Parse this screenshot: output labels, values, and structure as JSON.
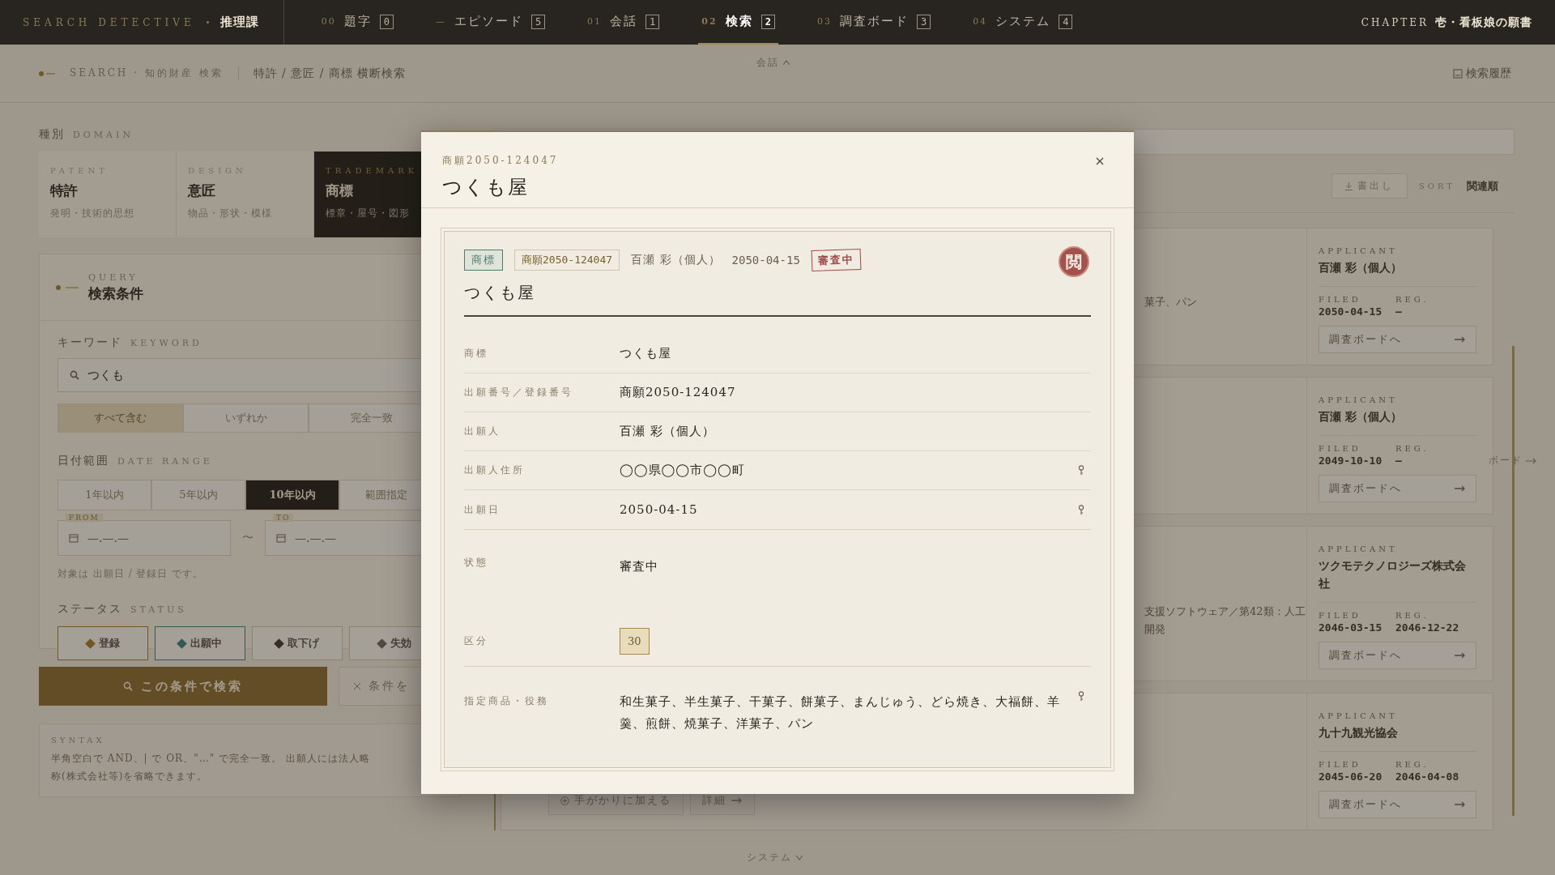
{
  "topbar": {
    "brand": "SEARCH DETECTIVE",
    "section": "推理課",
    "tabs": [
      {
        "num": "00",
        "label": "題字",
        "badge": "0",
        "selected": false
      },
      {
        "num": "—",
        "label": "エピソード",
        "badge": "5",
        "selected": false
      },
      {
        "num": "01",
        "label": "会話",
        "badge": "1",
        "selected": false
      },
      {
        "num": "02",
        "label": "検索",
        "badge": "2",
        "selected": true
      },
      {
        "num": "03",
        "label": "調査ボード",
        "badge": "3",
        "selected": false
      },
      {
        "num": "04",
        "label": "システム",
        "badge": "4",
        "selected": false
      }
    ],
    "chapter_label": "CHAPTER",
    "chapter": "壱・看板娘の願書"
  },
  "breadcrumb": {
    "section": "SEARCH · 知的財産 検索",
    "path": "特許 / 意匠 / 商標 横断検索",
    "history": "検索履歴"
  },
  "scroll_hints": [
    {
      "kind": "up",
      "label": "会話"
    },
    {
      "kind": "down",
      "label": "システム"
    },
    {
      "kind": "right",
      "label": "ボード"
    }
  ],
  "domain": {
    "label": "種別",
    "label_en": "DOMAIN",
    "tabs": [
      {
        "en": "PATENT",
        "title": "特許",
        "desc": "発明・技術的思想",
        "selected": false
      },
      {
        "en": "DESIGN",
        "title": "意匠",
        "desc": "物品・形状・模様",
        "selected": false
      },
      {
        "en": "TRADEMARK",
        "title": "商標",
        "desc": "標章・屋号・図形",
        "selected": true
      }
    ]
  },
  "query": {
    "label_en": "QUERY",
    "title": "検索条件",
    "keyword": {
      "label": "キーワード",
      "label_en": "KEYWORD",
      "value": "つくも"
    },
    "match_modes": [
      {
        "label": "すべて含む",
        "selected": true
      },
      {
        "label": "いずれか",
        "selected": false
      },
      {
        "label": "完全一致",
        "selected": false
      }
    ],
    "date": {
      "label": "日付範囲",
      "label_en": "DATE RANGE",
      "ranges": [
        {
          "label": "1年以内",
          "selected": false
        },
        {
          "label": "5年以内",
          "selected": false
        },
        {
          "label": "10年以内",
          "selected": true
        },
        {
          "label": "範囲指定",
          "selected": false
        }
      ],
      "from": {
        "label": "FROM",
        "placeholder": "—.—.—"
      },
      "separator": "〜",
      "to": {
        "label": "TO",
        "placeholder": "—.—.—"
      },
      "note": "対象は 出願日 / 登録日 です。"
    },
    "status": {
      "label": "ステータス",
      "label_en": "STATUS",
      "chips": [
        {
          "label": "登録",
          "kind": "registered"
        },
        {
          "label": "出願中",
          "kind": "pending"
        },
        {
          "label": "取下げ",
          "kind": "withdrawn"
        },
        {
          "label": "失効",
          "kind": "expired"
        }
      ]
    },
    "search_button": "この条件で検索",
    "clear_button": "条件を",
    "syntax": {
      "label": "SYNTAX",
      "lines": [
        "半角空白で AND、| で OR、\"…\" で完全一致。 出願人には法人略",
        "称(株式会社等)を省略できます。"
      ]
    }
  },
  "results": {
    "export": "書出し",
    "sort_label": "SORT",
    "sort_value": "関連順",
    "cards": [
      {
        "desc": [
          "菓子、パン"
        ],
        "applicant_label": "APPLICANT",
        "applicant": "百瀬 彩（個人）",
        "filed_label": "FILED",
        "filed": "2050-04-15",
        "reg_label": "REG.",
        "reg": "—",
        "board_button": "調査ボードへ"
      },
      {
        "applicant_label": "APPLICANT",
        "applicant": "百瀬 彩（個人）",
        "filed_label": "FILED",
        "filed": "2049-10-10",
        "reg_label": "REG.",
        "reg": "—",
        "board_button": "調査ボードへ"
      },
      {
        "desc": [
          "支援ソフトウェア／第42類：人工",
          "開発"
        ],
        "applicant_label": "APPLICANT",
        "applicant": "ツクモテクノロジーズ株式会社",
        "filed_label": "FILED",
        "filed": "2046-03-15",
        "reg_label": "REG.",
        "reg": "2046-12-22",
        "board_button": "調査ボードへ"
      },
      {
        "actions": [
          "手がかりに加える",
          "詳細"
        ],
        "applicant_label": "APPLICANT",
        "applicant": "九十九観光協会",
        "filed_label": "FILED",
        "filed": "2045-06-20",
        "reg_label": "REG.",
        "reg": "2046-04-08",
        "board_button": "調査ボードへ"
      }
    ]
  },
  "modal": {
    "number": "商願2050-124047",
    "title": "つくも屋",
    "tags": [
      {
        "kind": "type",
        "text": "商標"
      },
      {
        "kind": "number",
        "text": "商願2050-124047"
      },
      {
        "kind": "plain",
        "text": "百瀬 彩（個人）"
      },
      {
        "kind": "date",
        "text": "2050-04-15"
      },
      {
        "kind": "stamp",
        "text": "審査中"
      }
    ],
    "seal": "閲",
    "record_title": "つくも屋",
    "sections": [
      [
        {
          "kind": "text",
          "label": "商標",
          "value": "つくも屋",
          "pinned": false
        },
        {
          "kind": "text",
          "label": "出願番号／登録番号",
          "value": "商願2050-124047",
          "pinned": false
        },
        {
          "kind": "text",
          "label": "出願人",
          "value": "百瀬 彩（個人）",
          "pinned": false
        },
        {
          "kind": "text",
          "label": "出願人住所",
          "value": "◯◯県◯◯市◯◯町",
          "pinned": true
        },
        {
          "kind": "text",
          "label": "出願日",
          "value": "2050-04-15",
          "pinned": true
        }
      ],
      [
        {
          "kind": "tall",
          "label": "状態",
          "value": "審査中",
          "pinned": false
        },
        {
          "kind": "chip",
          "label": "区分",
          "value": "30",
          "pinned": false
        }
      ],
      [
        {
          "kind": "text",
          "label": "指定商品・役務",
          "value": "和生菓子、半生菓子、干菓子、餅菓子、まんじゅう、どら焼き、大福餅、羊羹、煎餅、焼菓子、洋菓子、パン",
          "pinned": true
        }
      ]
    ]
  }
}
